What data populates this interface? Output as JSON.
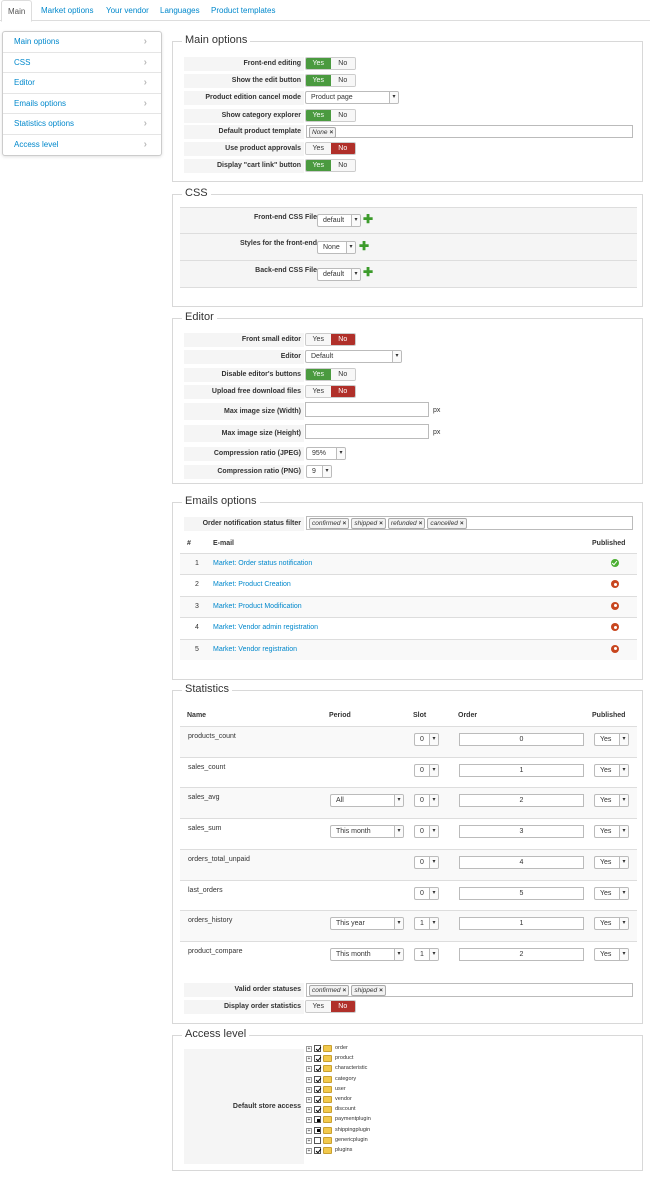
{
  "tabs": [
    "Main",
    "Market options",
    "Your vendor",
    "Languages",
    "Product templates"
  ],
  "sidebar": [
    "Main options",
    "CSS",
    "Editor",
    "Emails options",
    "Statistics options",
    "Access level"
  ],
  "yes_label": "Yes",
  "no_label": "No",
  "main_options": {
    "legend": "Main options",
    "frontend_editing": "Front-end editing",
    "show_edit_button": "Show the edit button",
    "cancel_mode": "Product edition cancel mode",
    "cancel_mode_value": "Product page",
    "show_category_explorer": "Show category explorer",
    "default_template": "Default product template",
    "default_template_tag": "None",
    "use_approvals": "Use product approvals",
    "display_cart_link": "Display \"cart link\" button"
  },
  "css": {
    "legend": "CSS",
    "frontend_file": "Front-end CSS File",
    "frontend_file_value": "default",
    "frontend_styles": "Styles for the front-end",
    "frontend_styles_value": "None",
    "backend_file": "Back-end CSS File",
    "backend_file_value": "default"
  },
  "editor": {
    "legend": "Editor",
    "front_small": "Front small editor",
    "editor": "Editor",
    "editor_value": "Default",
    "disable_buttons": "Disable editor's buttons",
    "upload_free": "Upload free download files",
    "max_width": "Max image size (Width)",
    "max_height": "Max image size (Height)",
    "unit": "px",
    "jpeg": "Compression ratio (JPEG)",
    "jpeg_value": "95%",
    "png": "Compression ratio (PNG)",
    "png_value": "9"
  },
  "emails": {
    "legend": "Emails options",
    "filter_label": "Order notification status filter",
    "filter_tags": [
      "confirmed",
      "shipped",
      "refunded",
      "cancelled"
    ],
    "col_num": "#",
    "col_email": "E-mail",
    "col_published": "Published",
    "rows": [
      {
        "num": "1",
        "name": "Market: Order status notification",
        "published": true
      },
      {
        "num": "2",
        "name": "Market: Product Creation",
        "published": false
      },
      {
        "num": "3",
        "name": "Market: Product Modification",
        "published": false
      },
      {
        "num": "4",
        "name": "Market: Vendor admin registration",
        "published": false
      },
      {
        "num": "5",
        "name": "Market: Vendor registration",
        "published": false
      }
    ]
  },
  "statistics": {
    "legend": "Statistics",
    "col_name": "Name",
    "col_period": "Period",
    "col_slot": "Slot",
    "col_order": "Order",
    "col_published": "Published",
    "rows": [
      {
        "name": "products_count",
        "period": "",
        "slot": "0",
        "order": "0",
        "published": "Yes"
      },
      {
        "name": "sales_count",
        "period": "",
        "slot": "0",
        "order": "1",
        "published": "Yes"
      },
      {
        "name": "sales_avg",
        "period": "All",
        "slot": "0",
        "order": "2",
        "published": "Yes"
      },
      {
        "name": "sales_sum",
        "period": "This month",
        "slot": "0",
        "order": "3",
        "published": "Yes"
      },
      {
        "name": "orders_total_unpaid",
        "period": "",
        "slot": "0",
        "order": "4",
        "published": "Yes"
      },
      {
        "name": "last_orders",
        "period": "",
        "slot": "0",
        "order": "5",
        "published": "Yes"
      },
      {
        "name": "orders_history",
        "period": "This year",
        "slot": "1",
        "order": "1",
        "published": "Yes"
      },
      {
        "name": "product_compare",
        "period": "This month",
        "slot": "1",
        "order": "2",
        "published": "Yes"
      }
    ],
    "valid_statuses_label": "Valid order statuses",
    "valid_statuses_tags": [
      "confirmed",
      "shipped"
    ],
    "display_stats_label": "Display order statistics"
  },
  "access": {
    "legend": "Access level",
    "label": "Default store access",
    "tree": [
      {
        "name": "order",
        "state": "on"
      },
      {
        "name": "product",
        "state": "on"
      },
      {
        "name": "characteristic",
        "state": "on"
      },
      {
        "name": "category",
        "state": "on"
      },
      {
        "name": "user",
        "state": "on"
      },
      {
        "name": "vendor",
        "state": "on"
      },
      {
        "name": "discount",
        "state": "on"
      },
      {
        "name": "paymentplugin",
        "state": "part"
      },
      {
        "name": "shippingplugin",
        "state": "part"
      },
      {
        "name": "genericplugin",
        "state": "off"
      },
      {
        "name": "plugins",
        "state": "on"
      }
    ]
  }
}
